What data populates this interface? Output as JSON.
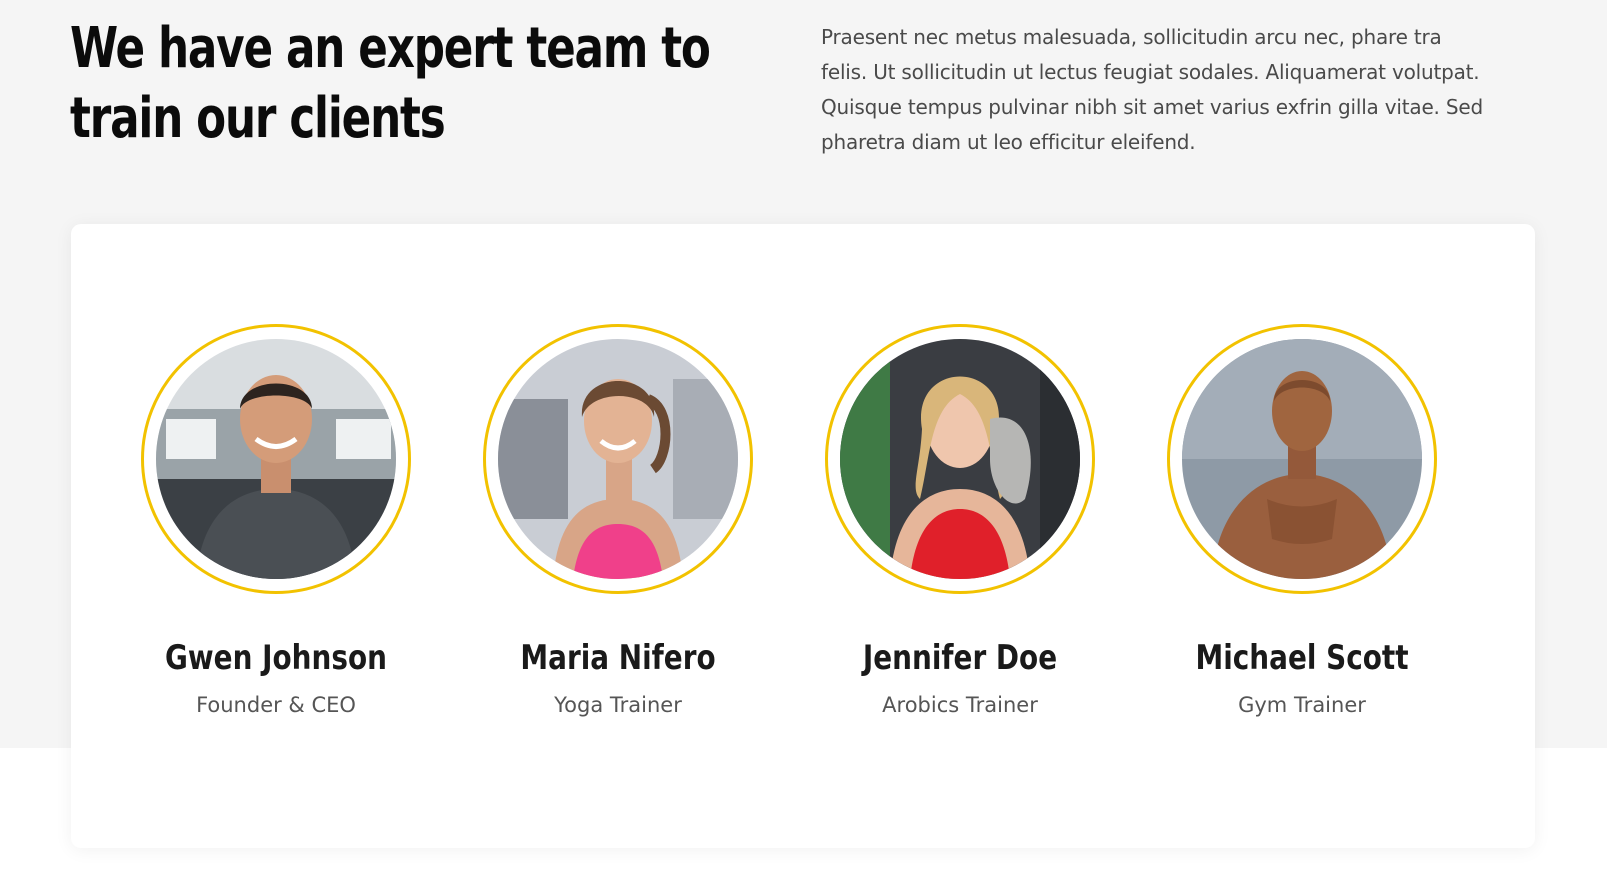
{
  "section": {
    "heading_lines": [
      "We have an expert team to",
      "train our clients"
    ],
    "intro_lines": [
      "Praesent nec metus malesuada, sollicitudin arcu nec, phare tra",
      "felis. Ut sollicitudin ut lectus feugiat sodales. Aliquamerat volutpat.",
      "Quisque tempus pulvinar nibh sit amet varius exfrin gilla vitae. Sed",
      "pharetra diam ut leo efficitur eleifend."
    ]
  },
  "team": [
    {
      "name": "Gwen Johnson",
      "role": "Founder & CEO"
    },
    {
      "name": "Maria Nifero",
      "role": "Yoga Trainer"
    },
    {
      "name": "Jennifer Doe",
      "role": "Arobics Trainer"
    },
    {
      "name": "Michael Scott",
      "role": "Gym Trainer"
    }
  ],
  "colors": {
    "accent": "#f2c200",
    "background": "#f5f5f5",
    "card": "#ffffff",
    "heading": "#0b0b0b",
    "body_text": "#4a4a4a"
  }
}
